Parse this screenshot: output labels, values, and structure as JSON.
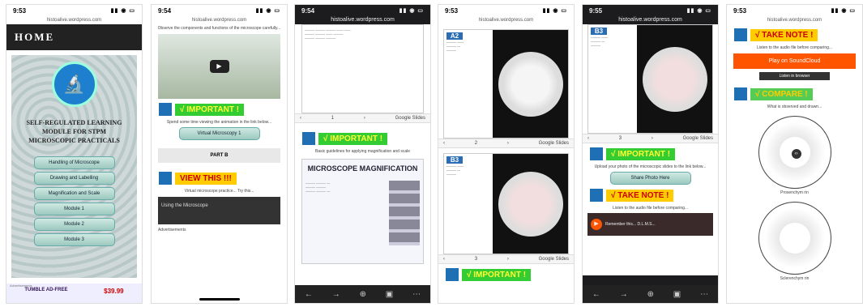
{
  "p1": {
    "time": "9:53",
    "url": "histoalive.wordpress.com",
    "home": "HOME",
    "title": "SELF-REGULATED LEARNING MODULE FOR STPM MICROSCOPIC PRACTICALS",
    "buttons": [
      "Handling of Microscope",
      "Drawing and Labelling",
      "Magnification and Scale",
      "Module 1",
      "Module 2",
      "Module 3"
    ],
    "ad_label": "Advertisements",
    "ad_text": "TUMBLE AD-FREE",
    "price": "$39.99"
  },
  "p2": {
    "time": "9:54",
    "url": "histoalive.wordpress.com",
    "intro": "Observe the components and functions of the microscope carefully...",
    "important": "√ IMPORTANT !",
    "desc": "Spend some time viewing the animation in the link below...",
    "link": "Virtual Microscopy 1",
    "part": "PART B",
    "view": "VIEW THIS !!!",
    "desc2": "Virtual microscope practice... Try this...",
    "video": "Using the Microscope",
    "ad_label": "Advertisements"
  },
  "p3": {
    "time": "9:54",
    "url": "histoalive.wordpress.com",
    "page": "1",
    "gs": "Google Slides",
    "important": "√ IMPORTANT !",
    "desc": "Basic guidelines for applying magnification and scale",
    "mag_title": "MICROSCOPE MAGNIFICATION"
  },
  "p4": {
    "time": "9:53",
    "url": "histoalive.wordpress.com",
    "a2": "A2",
    "b3": "B3",
    "page1": "2",
    "page2": "3",
    "gs": "Google Slides",
    "important": "√ IMPORTANT !"
  },
  "p5": {
    "time": "9:55",
    "url": "histoalive.wordpress.com",
    "b3": "B3",
    "page": "3",
    "gs": "Google Slides",
    "important": "√ IMPORTANT !",
    "desc": "Upload your photo of the microscopic slides to the link below...",
    "share": "Share Photo Here",
    "note": "√ TAKE NOTE !",
    "desc2": "Listen to the audio file before comparing...",
    "audio": "Remember this... D.L.M.S..."
  },
  "p6": {
    "time": "9:53",
    "url": "histoalive.wordpress.com",
    "note": "√ TAKE NOTE !",
    "desc": "Listen to the audio file before comparing...",
    "sc": "Play on SoundCloud",
    "browser": "Listen in browser",
    "compare": "√ COMPARE !",
    "desc2": "What is observed and drawn...",
    "cap1": "Prosenchym rin",
    "cap2": "Sclerenchym rin"
  }
}
